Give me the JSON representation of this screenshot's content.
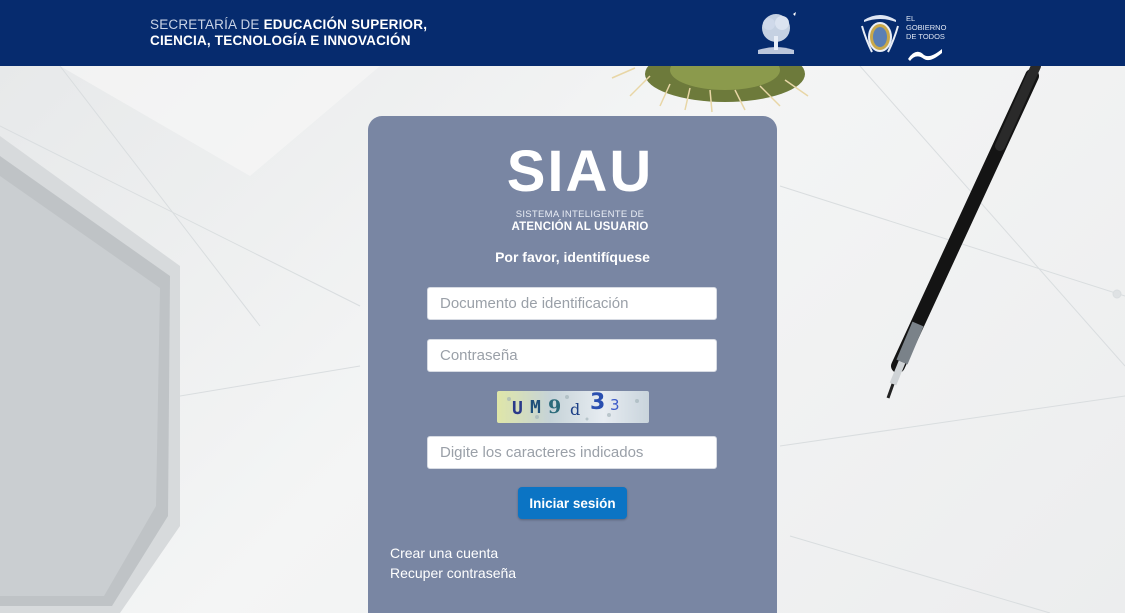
{
  "header": {
    "brand_line1_light": "SECRETARÍA DE",
    "brand_line1_bold": "EDUCACIÓN SUPERIOR,",
    "brand_line2": "CIENCIA, TECNOLOGÍA E INNOVACIÓN",
    "tree_logo_icon": "tree-logo-icon",
    "government_text": [
      "EL",
      "GOBIERNO",
      "DE TODOS"
    ],
    "government_icon": "coat-of-arms-icon",
    "colors": {
      "bar": "#062b6e"
    }
  },
  "card": {
    "logo": "SIAU",
    "logo_sub1": "SISTEMA INTELIGENTE DE",
    "logo_sub2": "ATENCIÓN AL USUARIO",
    "prompt": "Por favor, identifíquese",
    "document_placeholder": "Documento de identificación",
    "password_placeholder": "Contraseña",
    "captcha_text": "UM9d33",
    "captcha_placeholder": "Digite los caracteres indicados",
    "login_label": "Iniciar sesión",
    "create_account_label": "Crear una cuenta",
    "recover_password_label": "Recuper contraseña",
    "colors": {
      "card": "#7986a3",
      "button": "#0b74c4"
    }
  }
}
